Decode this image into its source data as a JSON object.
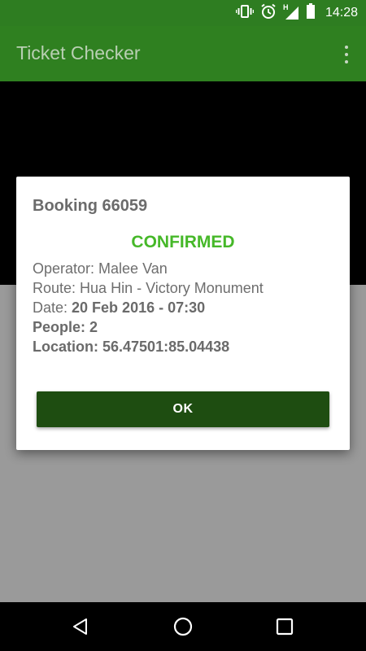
{
  "status_bar": {
    "time": "14:28",
    "network_label": "H",
    "icons": [
      "vibrate-icon",
      "alarm-icon",
      "signal-icon",
      "battery-icon"
    ]
  },
  "app_bar": {
    "title": "Ticket Checker",
    "menu_icon": "overflow-menu-icon"
  },
  "dialog": {
    "title": "Booking 66059",
    "status": "CONFIRMED",
    "operator_label": "Operator: ",
    "operator_value": "Malee Van",
    "route_label": "Route: ",
    "route_value": "Hua Hin - Victory Monument",
    "date_label": "Date: ",
    "date_value": "20 Feb 2016 - 07:30",
    "people_label": "People: ",
    "people_value": "2",
    "location_label": "Location: ",
    "location_value": "56.47501:85.04438",
    "ok_label": "OK"
  },
  "nav_bar": {
    "icons": [
      "back-icon",
      "home-icon",
      "recents-icon"
    ]
  },
  "colors": {
    "status_bar": "#2e7d21",
    "app_bar": "#2f8020",
    "confirmed": "#46b829",
    "ok_button": "#1e4d11"
  }
}
